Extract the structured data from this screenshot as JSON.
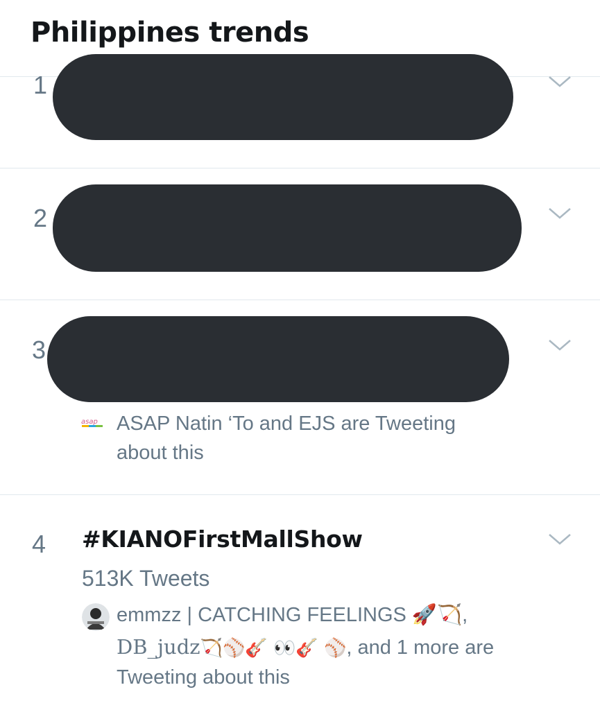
{
  "header": {
    "title": "Philippines trends"
  },
  "trends": [
    {
      "rank": "1",
      "redacted": true
    },
    {
      "rank": "2",
      "redacted": true
    },
    {
      "rank": "3",
      "redacted": true,
      "context": {
        "avatar_label": "asap",
        "line1": "ASAP Natin ‘To and EJS are Tweeting",
        "line2": "about this"
      }
    },
    {
      "rank": "4",
      "name": "#KIANOFirstMallShow",
      "tweet_count": "513K Tweets",
      "context": {
        "line1": "emmzz | CATCHING FEELINGS 🚀🏹,",
        "handle": "DB_judz",
        "handle_emojis": "🏹⚾🎸 👀🎸 ⚾",
        "line2_rest": ", and 1 more are",
        "line3": "Tweeting about this"
      }
    }
  ],
  "icons": {
    "more": "chevron-down-icon"
  },
  "colors": {
    "text": "#14171a",
    "secondary": "#657786",
    "divider": "#e1e8ed",
    "redaction": "#2a2e33"
  }
}
